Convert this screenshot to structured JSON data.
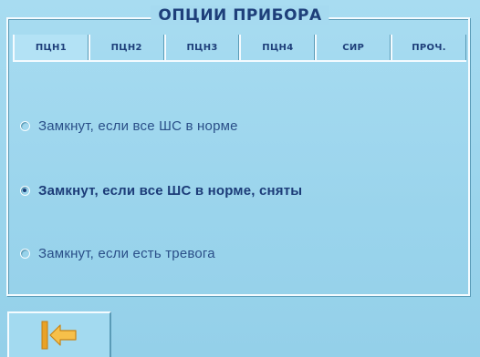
{
  "group": {
    "title": "ОПЦИИ ПРИБОРА"
  },
  "tabs": [
    {
      "label": "ПЦН1",
      "active": true
    },
    {
      "label": "ПЦН2",
      "active": false
    },
    {
      "label": "ПЦН3",
      "active": false
    },
    {
      "label": "ПЦН4",
      "active": false
    },
    {
      "label": "СИР",
      "active": false
    },
    {
      "label": "ПРОЧ.",
      "active": false
    }
  ],
  "options": [
    {
      "label": "Замкнут, если все ШС в норме",
      "selected": false
    },
    {
      "label": "Замкнут, если все ШС в норме, сняты",
      "selected": true
    },
    {
      "label": "Замкнут, если есть тревога",
      "selected": false
    }
  ],
  "bottom": {
    "back_icon": "exit-arrow-icon"
  },
  "colors": {
    "background": "#9fd7ee",
    "text": "#1e3f7a",
    "frame_light": "#f4fbff",
    "frame_dark": "#5a9bb7",
    "icon_orange": "#f4b335"
  }
}
